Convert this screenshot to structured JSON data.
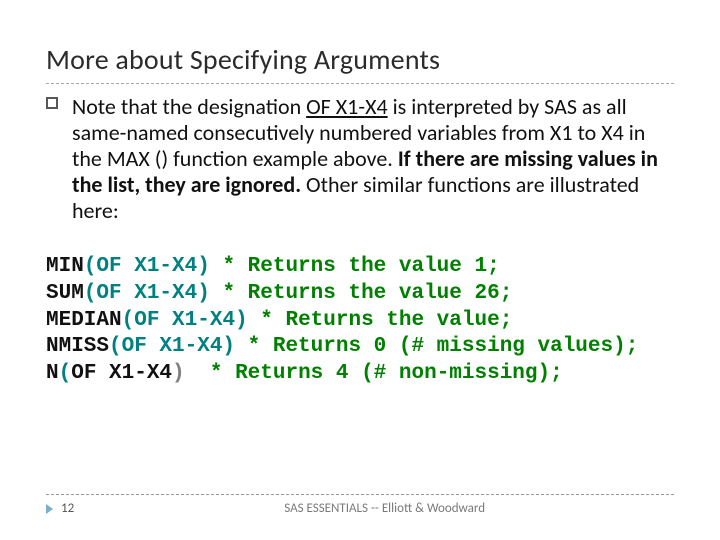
{
  "slide": {
    "title": "More about Specifying Arguments",
    "body_parts": {
      "p1a": "Note that the designation ",
      "p1b": "OF X1-X4",
      "p1c": " is interpreted by SAS as all same-named consecutively numbered variables from X1 to X4 in the MAX () function example above. ",
      "p1d": "If there are missing values in the list, they are ignored.",
      "p1e": " Other similar functions are illustrated here:"
    },
    "code": {
      "l1": {
        "fn": "MIN",
        "arg": "(OF X1-X4)",
        "c1": " * Returns the value 1",
        "c2": ";"
      },
      "l2": {
        "fn": "SUM",
        "arg": "(OF X1-X4)",
        "c1": " * Returns the value 26",
        "c2": ";"
      },
      "l3": {
        "fn": "MEDIAN",
        "arg": "(OF X1-X4)",
        "c1": " * Returns the value",
        "c2": ";"
      },
      "l4": {
        "fn": "NMISS",
        "arg": "(OF X1-X4)",
        "c1": " * Returns 0 (# missing values)",
        "c2": ";"
      },
      "l5": {
        "fn": "N",
        "arg_open": "(",
        "arg_mid": "OF X1-X4",
        "arg_close": ")",
        "c1": "  * Returns 4 (# non-missing)",
        "c2": ";"
      }
    },
    "footer": {
      "page": "12",
      "center": "SAS ESSENTIALS -- Elliott & Woodward"
    }
  }
}
